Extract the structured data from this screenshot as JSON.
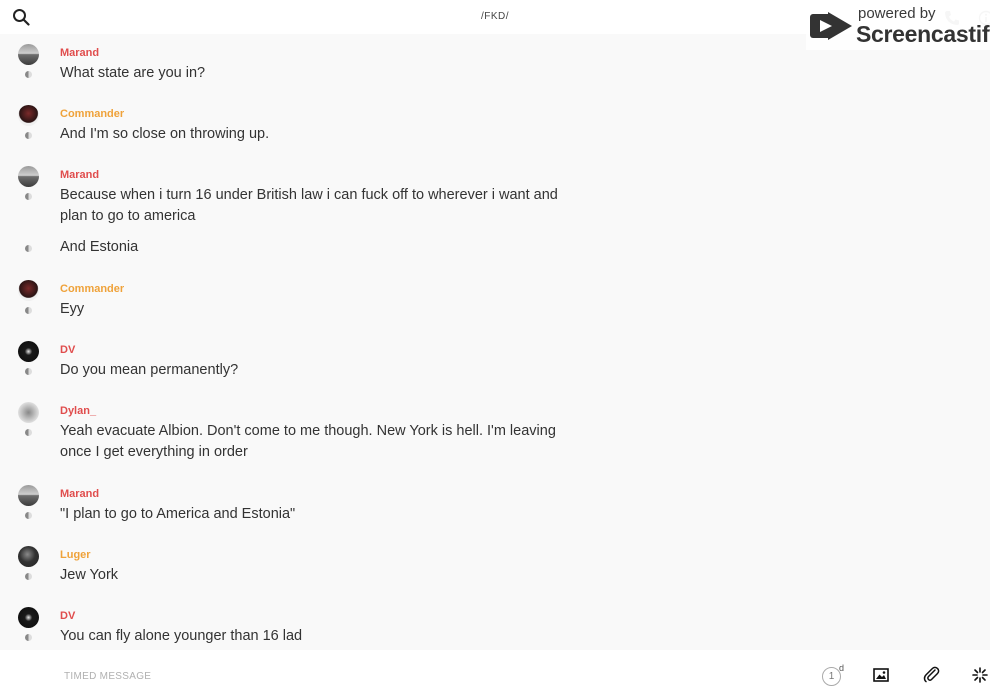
{
  "header": {
    "channel_title": "/FKD/",
    "watermark_top": "powered by",
    "watermark_brand": "Screencastify"
  },
  "messages": [
    {
      "author": "Marand",
      "author_color": "#e04d4d",
      "avatar": "marand",
      "lines": [
        "What state are you in?"
      ]
    },
    {
      "author": "Commander",
      "author_color": "#efa23a",
      "avatar": "commander",
      "lines": [
        "And I'm so close on throwing up."
      ]
    },
    {
      "author": "Marand",
      "author_color": "#e04d4d",
      "avatar": "marand",
      "lines": [
        "Because when i turn 16 under British law i can fuck off to wherever i want and plan to go to america",
        "And Estonia"
      ]
    },
    {
      "author": "Commander",
      "author_color": "#efa23a",
      "avatar": "commander",
      "lines": [
        "Eyy"
      ]
    },
    {
      "author": "DV",
      "author_color": "#e04d4d",
      "avatar": "dv",
      "lines": [
        "Do you mean permanently?"
      ]
    },
    {
      "author": "Dylan_",
      "author_color": "#e04d4d",
      "avatar": "dylan",
      "lines": [
        "Yeah evacuate Albion. Don't come to me though. New York is hell. I'm leaving once I get everything in order"
      ]
    },
    {
      "author": "Marand",
      "author_color": "#e04d4d",
      "avatar": "marand",
      "lines": [
        "\"I plan to go to America and Estonia\""
      ]
    },
    {
      "author": "Luger",
      "author_color": "#efa23a",
      "avatar": "luger",
      "lines": [
        "Jew York"
      ]
    },
    {
      "author": "DV",
      "author_color": "#e04d4d",
      "avatar": "dv",
      "lines": [
        "You can fly alone younger than 16 lad"
      ]
    }
  ],
  "composer": {
    "placeholder": "TIMED MESSAGE",
    "timer_value": "1",
    "timer_unit": "d"
  }
}
